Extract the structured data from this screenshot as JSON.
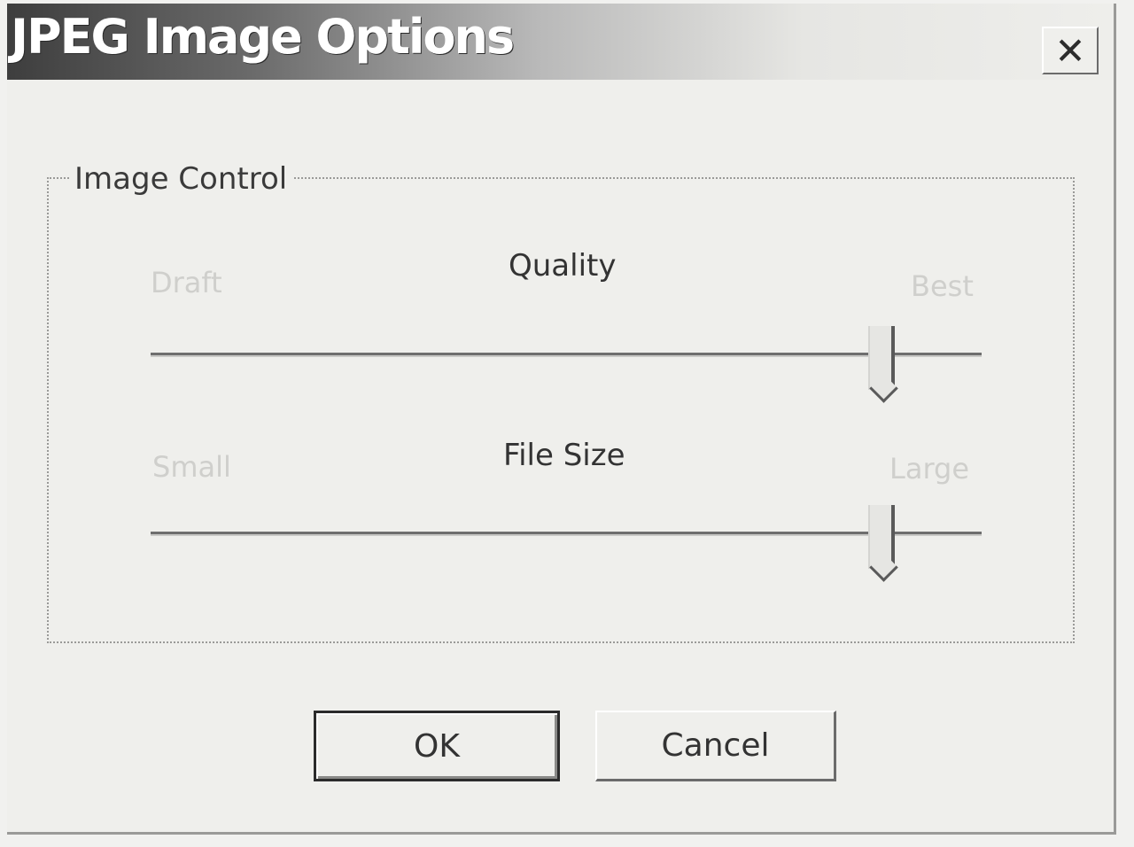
{
  "window": {
    "title": "JPEG Image Options",
    "close_glyph": "✕"
  },
  "group": {
    "label": "Image Control"
  },
  "quality": {
    "title": "Quality",
    "min_label": "Draft",
    "max_label": "Best",
    "value_fraction": 0.88
  },
  "file_size": {
    "title": "File Size",
    "min_label": "Small",
    "max_label": "Large",
    "value_fraction": 0.88
  },
  "buttons": {
    "ok": "OK",
    "cancel": "Cancel"
  },
  "colors": {
    "dialog_background": "#efefec",
    "title_text": "#ffffff",
    "disabled_text": "#cfcfcc"
  },
  "icons": {
    "close": "close-icon"
  }
}
